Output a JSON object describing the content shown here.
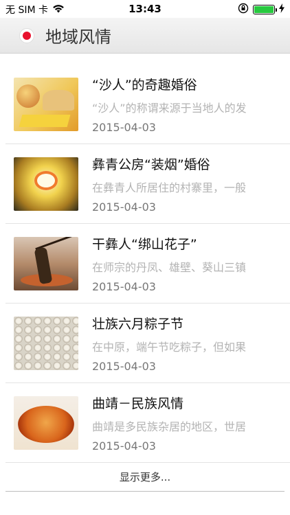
{
  "status_bar": {
    "carrier": "无 SIM 卡",
    "wifi_icon": "wifi-icon",
    "time": "13:43",
    "lock_icon": "rotation-lock-icon",
    "battery_icon": "battery-icon",
    "charging_icon": "charging-bolt-icon",
    "battery_level": 1.0
  },
  "nav": {
    "icon": "red-dot-logo-icon",
    "title": "地域风情",
    "accent": "#e8112d"
  },
  "items": [
    {
      "title": "“沙人”的奇趣婚俗",
      "desc": "“沙人”的称谓来源于当地人的发",
      "date": "2015-04-03"
    },
    {
      "title": "彝青公房“装烟”婚俗",
      "desc": "在彝青人所居住的村寨里，一般",
      "date": "2015-04-03"
    },
    {
      "title": "干彝人“绑山花子”",
      "desc": "在师宗的丹凤、雄壁、葵山三镇",
      "date": "2015-04-03"
    },
    {
      "title": "壮族六月粽子节",
      "desc": "在中原，端午节吃粽子，但如果",
      "date": "2015-04-03"
    },
    {
      "title": "曲靖－民族风情",
      "desc": "曲靖是多民族杂居的地区，世居",
      "date": "2015-04-03"
    }
  ],
  "more_label": "显示更多..."
}
